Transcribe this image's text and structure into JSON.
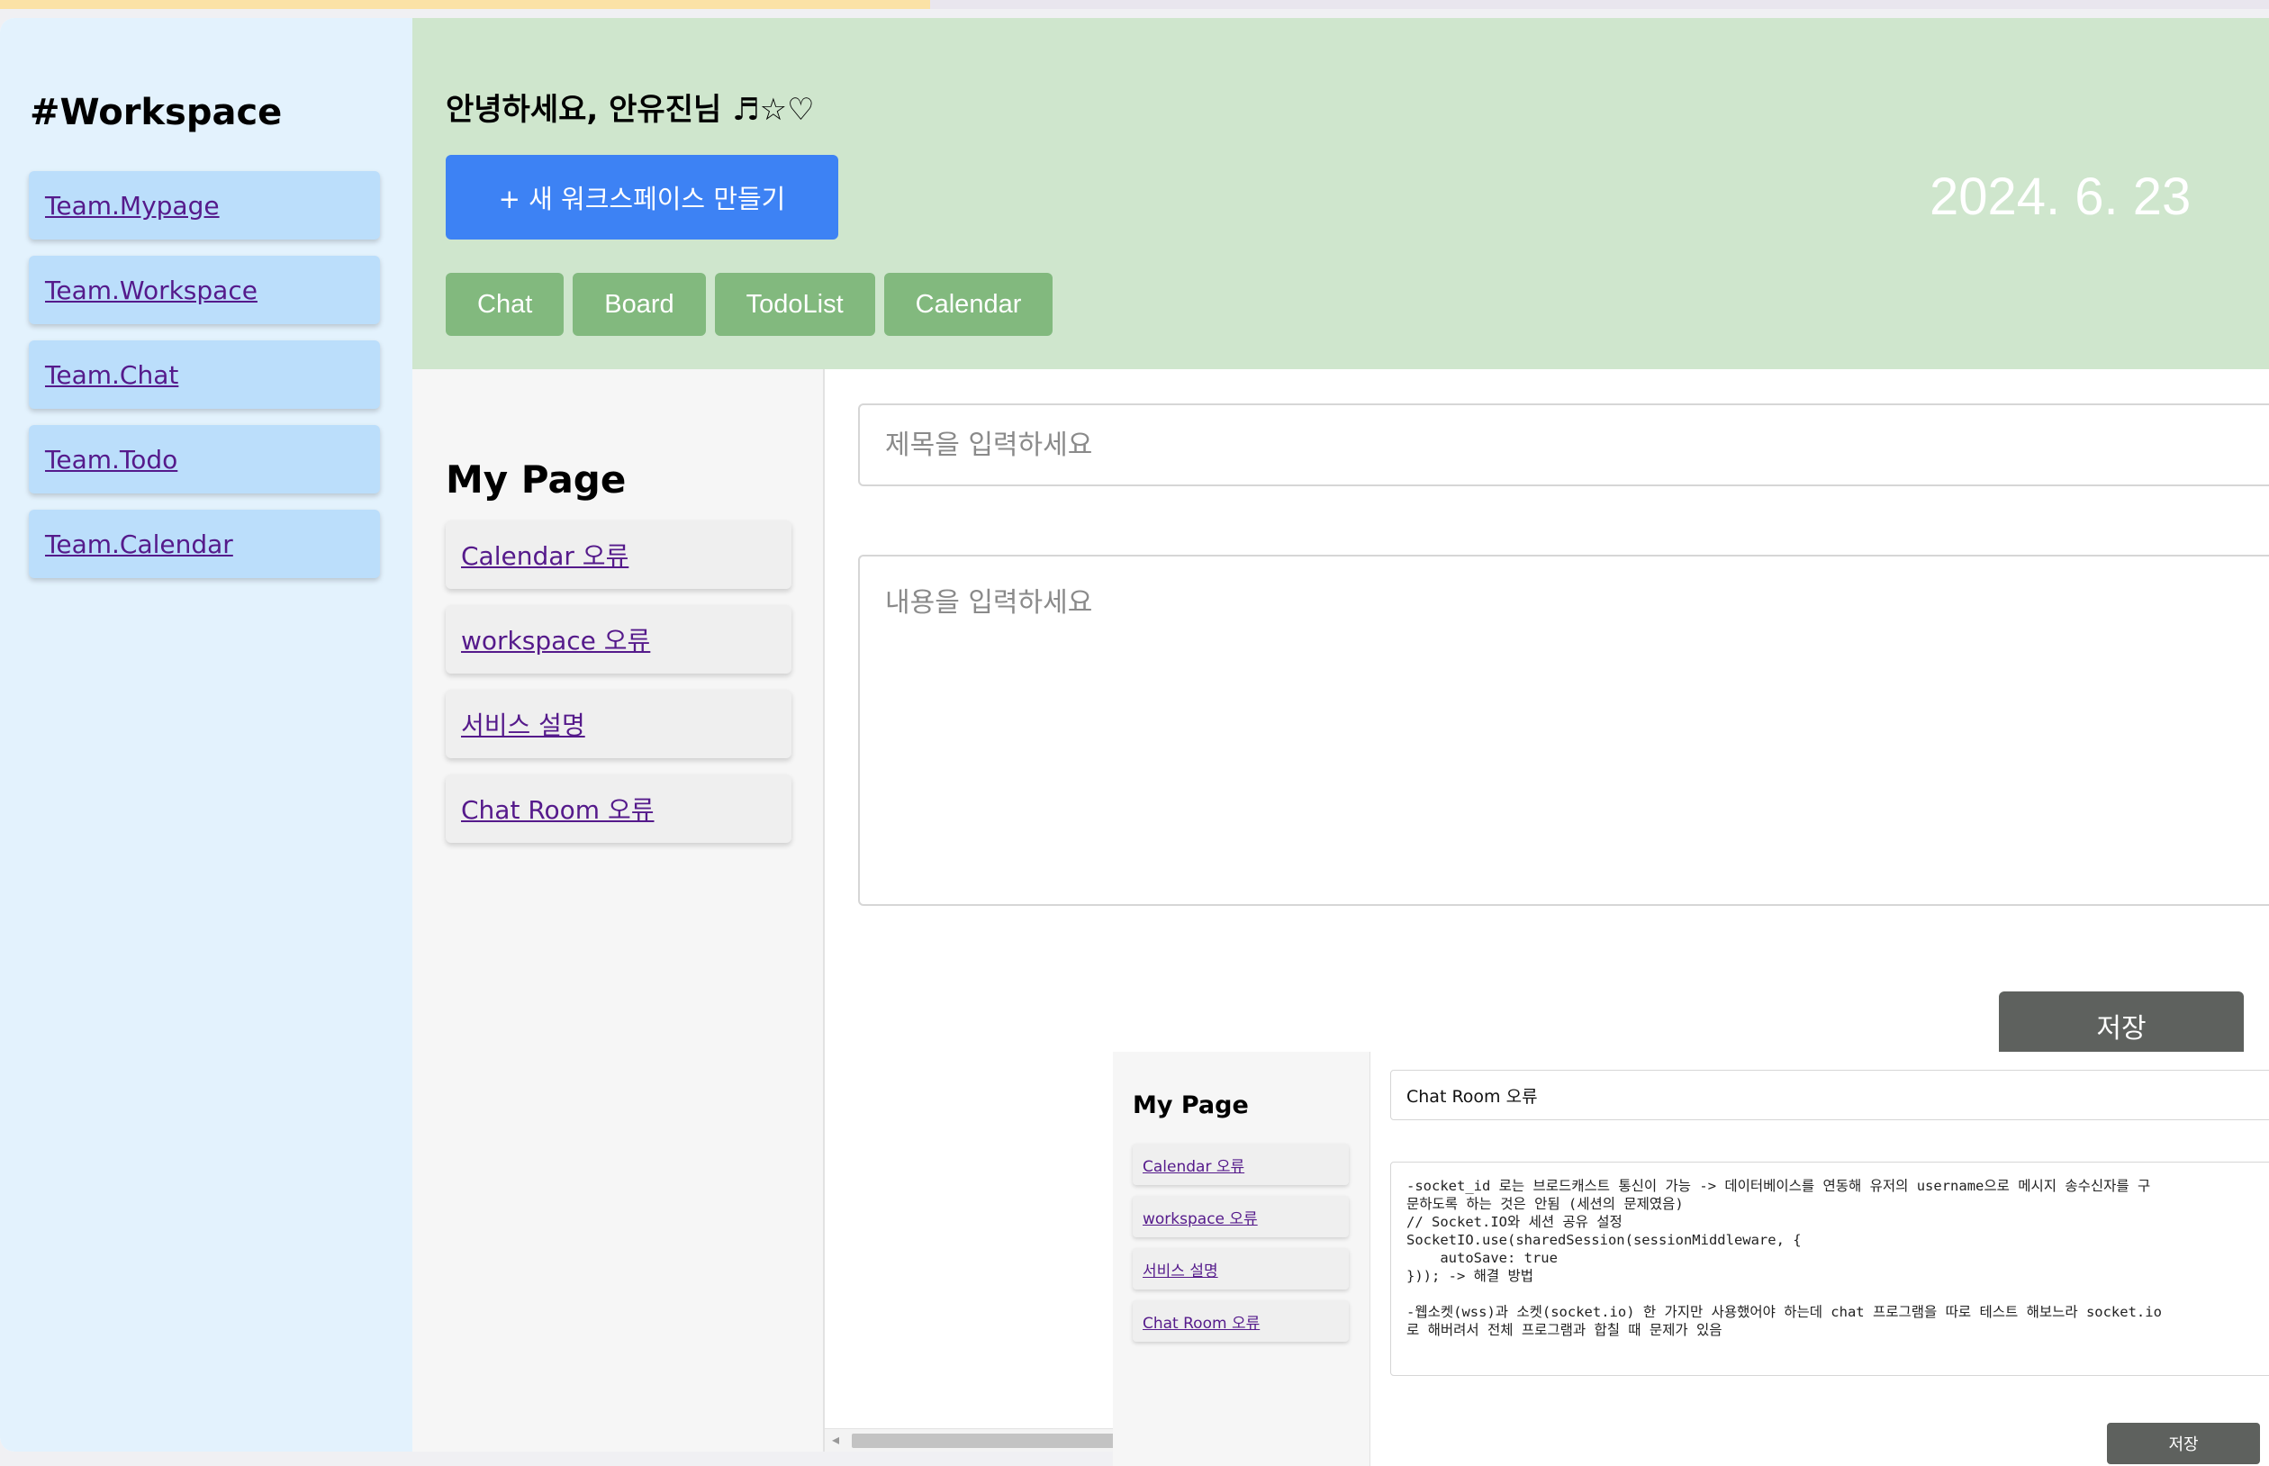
{
  "colors": {
    "sidebar_bg": "#e3f2fd",
    "sidebar_item_bg": "#bbdefb",
    "header_bg": "#cfe6cd",
    "primary_button": "#3d82f4",
    "tab_button": "#82b97e",
    "save_button": "#5e615e"
  },
  "top_progress": 0.41,
  "sidebar": {
    "title": "#Workspace",
    "items": [
      {
        "label": "Team.Mypage"
      },
      {
        "label": "Team.Workspace"
      },
      {
        "label": "Team.Chat"
      },
      {
        "label": "Team.Todo"
      },
      {
        "label": "Team.Calendar"
      }
    ]
  },
  "header": {
    "greeting": "안녕하세요, 안유진님 ♬☆♡",
    "new_workspace_label": "+ 새 워크스페이스 만들기",
    "date": "2024. 6. 23",
    "tabs": [
      {
        "label": "Chat"
      },
      {
        "label": "Board"
      },
      {
        "label": "TodoList"
      },
      {
        "label": "Calendar"
      }
    ]
  },
  "mypage": {
    "title": "My Page",
    "posts": [
      {
        "label": "Calendar 오류"
      },
      {
        "label": "workspace 오류"
      },
      {
        "label": "서비스 설명"
      },
      {
        "label": "Chat Room 오류"
      }
    ]
  },
  "editor": {
    "title_placeholder": "제목을 입력하세요",
    "content_placeholder": "내용을 입력하세요",
    "save_label": "저장"
  },
  "overlay": {
    "title": "My Page",
    "posts": [
      {
        "label": "Calendar 오류"
      },
      {
        "label": "workspace 오류"
      },
      {
        "label": "서비스 설명"
      },
      {
        "label": "Chat Room 오류"
      }
    ],
    "post_title": "Chat Room 오류",
    "post_content": "-socket_id 로는 브로드캐스트 통신이 가능 -> 데이터베이스를 연동해 유저의 username으로 메시지 송수신자를 구\n문하도록 하는 것은 안됨 (세션의 문제였음)\n// Socket.IO와 세션 공유 설정\nSocketIO.use(sharedSession(sessionMiddleware, {\n    autoSave: true\n})); -> 해결 방법\n\n-웹소켓(wss)과 소켓(socket.io) 한 가지만 사용했어야 하는데 chat 프로그램을 따로 테스트 해보느라 socket.io\n로 해버려서 전체 프로그램과 합칠 때 문제가 있음",
    "save_label": "저장"
  }
}
